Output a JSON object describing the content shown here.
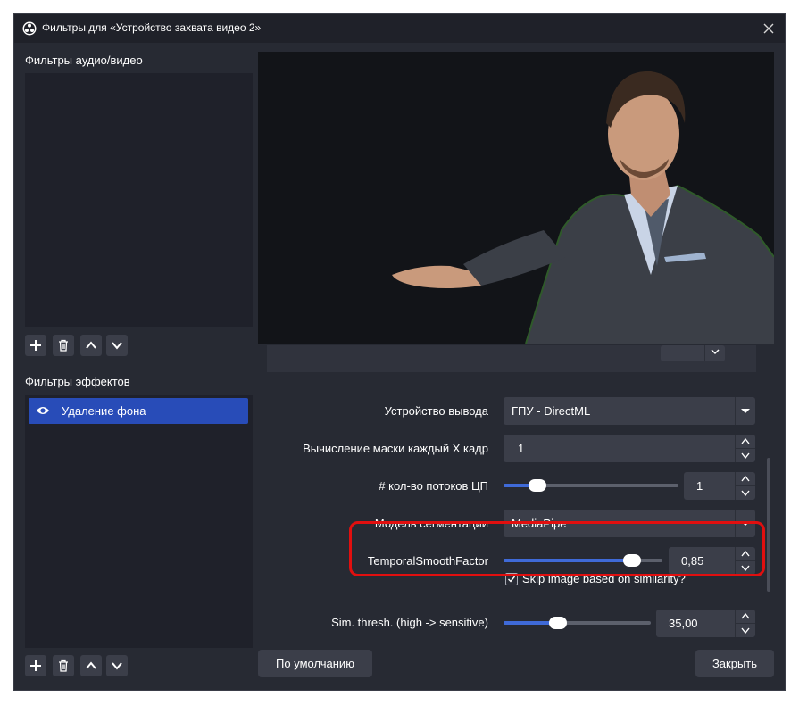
{
  "window": {
    "title": "Фильтры для «Устройство захвата видео 2»"
  },
  "left": {
    "audio_video_label": "Фильтры аудио/видео",
    "effects_label": "Фильтры эффектов",
    "effects_items": [
      {
        "name": "Удаление фона",
        "visible": true,
        "selected": true
      }
    ]
  },
  "props": {
    "output_device_label": "Устройство вывода",
    "output_device_value": "ГПУ - DirectML",
    "mask_every_label": "Вычисление маски каждый X кадр",
    "mask_every_value": "1",
    "cpu_threads_label": "# кол-во потоков ЦП",
    "cpu_threads_value": "1",
    "cpu_threads_fraction": 0.16,
    "segmentation_label": "Модель сегментации",
    "segmentation_value": "MediaPipe",
    "temporal_label": "TemporalSmoothFactor",
    "temporal_value": "0,85",
    "temporal_fraction": 0.85,
    "skip_label": "Skip image based on similarity?",
    "skip_checked": true,
    "sim_label": "Sim. thresh. (high -> sensitive)",
    "sim_value": "35,00",
    "sim_fraction": 0.35
  },
  "buttons": {
    "defaults": "По умолчанию",
    "close": "Закрыть"
  },
  "colors": {
    "accent": "#284cb8",
    "slider": "#3f6ad8",
    "highlight": "#e10f0f"
  }
}
